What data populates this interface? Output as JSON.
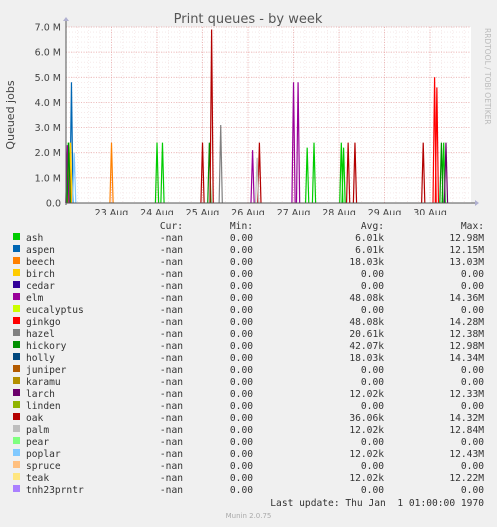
{
  "chart_data": {
    "type": "line",
    "title": "Print queues - by week",
    "ylabel": "Queued jobs",
    "side_text": "RRDTOOL / TOBI OETIKER",
    "ylim": [
      0,
      7000000
    ],
    "yticks": [
      {
        "value": 0,
        "label": "0.0"
      },
      {
        "value": 1000000,
        "label": "1.0 M"
      },
      {
        "value": 2000000,
        "label": "2.0 M"
      },
      {
        "value": 3000000,
        "label": "3.0 M"
      },
      {
        "value": 4000000,
        "label": "4.0 M"
      },
      {
        "value": 5000000,
        "label": "5.0 M"
      },
      {
        "value": 6000000,
        "label": "6.0 M"
      },
      {
        "value": 7000000,
        "label": "7.0 M"
      }
    ],
    "xlim": [
      22.0,
      30.9
    ],
    "xticks": [
      {
        "value": 23,
        "label": "23 Aug"
      },
      {
        "value": 24,
        "label": "24 Aug"
      },
      {
        "value": 25,
        "label": "25 Aug"
      },
      {
        "value": 26,
        "label": "26 Aug"
      },
      {
        "value": 27,
        "label": "27 Aug"
      },
      {
        "value": 28,
        "label": "28 Aug"
      },
      {
        "value": 29,
        "label": "29 Aug"
      },
      {
        "value": 30,
        "label": "30 Aug"
      }
    ],
    "series": [
      {
        "name": "ash",
        "color": "#00cc00",
        "spikes": [
          [
            22.05,
            2.4
          ],
          [
            24.0,
            2.4
          ],
          [
            24.12,
            2.4
          ],
          [
            27.3,
            2.2
          ],
          [
            27.45,
            2.4
          ],
          [
            28.05,
            2.4
          ],
          [
            28.1,
            2.2
          ],
          [
            30.3,
            2.4
          ]
        ]
      },
      {
        "name": "aspen",
        "color": "#0066b3",
        "spikes": [
          [
            22.12,
            4.8
          ]
        ]
      },
      {
        "name": "beech",
        "color": "#ff8000",
        "spikes": [
          [
            22.08,
            2.0
          ],
          [
            23.0,
            2.4
          ]
        ]
      },
      {
        "name": "birch",
        "color": "#ffcc00",
        "spikes": [
          [
            22.1,
            2.4
          ]
        ]
      },
      {
        "name": "cedar",
        "color": "#330099",
        "spikes": []
      },
      {
        "name": "elm",
        "color": "#990099",
        "spikes": [
          [
            22.03,
            2.3
          ],
          [
            26.1,
            2.1
          ],
          [
            27.0,
            4.8
          ],
          [
            27.1,
            4.8
          ]
        ]
      },
      {
        "name": "eucalyptus",
        "color": "#ccff00",
        "spikes": []
      },
      {
        "name": "ginkgo",
        "color": "#ff0000",
        "spikes": [
          [
            30.1,
            5.0
          ],
          [
            30.15,
            4.6
          ]
        ]
      },
      {
        "name": "hazel",
        "color": "#808080",
        "spikes": [
          [
            25.4,
            3.1
          ]
        ]
      },
      {
        "name": "hickory",
        "color": "#008f00",
        "spikes": [
          [
            22.06,
            2.4
          ],
          [
            25.15,
            2.4
          ],
          [
            30.25,
            2.4
          ]
        ]
      },
      {
        "name": "holly",
        "color": "#00487d",
        "spikes": []
      },
      {
        "name": "juniper",
        "color": "#b35a00",
        "spikes": []
      },
      {
        "name": "karamu",
        "color": "#b38f00",
        "spikes": []
      },
      {
        "name": "larch",
        "color": "#6b006b",
        "spikes": [
          [
            30.35,
            2.4
          ]
        ]
      },
      {
        "name": "linden",
        "color": "#8fb300",
        "spikes": []
      },
      {
        "name": "oak",
        "color": "#b30000",
        "spikes": [
          [
            25.0,
            2.4
          ],
          [
            25.2,
            6.9
          ],
          [
            26.25,
            2.4
          ],
          [
            28.2,
            2.4
          ],
          [
            28.35,
            2.4
          ],
          [
            29.85,
            2.4
          ]
        ]
      },
      {
        "name": "palm",
        "color": "#bebebe",
        "spikes": [
          [
            26.2,
            1.8
          ]
        ]
      },
      {
        "name": "pear",
        "color": "#80ff80",
        "spikes": []
      },
      {
        "name": "poplar",
        "color": "#80c9ff",
        "spikes": [
          [
            22.18,
            2.0
          ]
        ]
      },
      {
        "name": "spruce",
        "color": "#ffc080",
        "spikes": []
      },
      {
        "name": "teak",
        "color": "#ffe680",
        "spikes": []
      },
      {
        "name": "tnh23prntr",
        "color": "#aa80ff",
        "spikes": []
      }
    ]
  },
  "legend": {
    "headers": {
      "cur": "Cur:",
      "min": "Min:",
      "avg": "Avg:",
      "max": "Max:"
    },
    "rows": [
      {
        "name": "ash",
        "color": "#00cc00",
        "cur": "-nan",
        "min": "0.00",
        "avg": "6.01k",
        "max": "12.98M"
      },
      {
        "name": "aspen",
        "color": "#0066b3",
        "cur": "-nan",
        "min": "0.00",
        "avg": "6.01k",
        "max": "12.15M"
      },
      {
        "name": "beech",
        "color": "#ff8000",
        "cur": "-nan",
        "min": "0.00",
        "avg": "18.03k",
        "max": "13.03M"
      },
      {
        "name": "birch",
        "color": "#ffcc00",
        "cur": "-nan",
        "min": "0.00",
        "avg": "0.00",
        "max": "0.00"
      },
      {
        "name": "cedar",
        "color": "#330099",
        "cur": "-nan",
        "min": "0.00",
        "avg": "0.00",
        "max": "0.00"
      },
      {
        "name": "elm",
        "color": "#990099",
        "cur": "-nan",
        "min": "0.00",
        "avg": "48.08k",
        "max": "14.36M"
      },
      {
        "name": "eucalyptus",
        "color": "#ccff00",
        "cur": "-nan",
        "min": "0.00",
        "avg": "0.00",
        "max": "0.00"
      },
      {
        "name": "ginkgo",
        "color": "#ff0000",
        "cur": "-nan",
        "min": "0.00",
        "avg": "48.08k",
        "max": "14.28M"
      },
      {
        "name": "hazel",
        "color": "#808080",
        "cur": "-nan",
        "min": "0.00",
        "avg": "20.61k",
        "max": "12.38M"
      },
      {
        "name": "hickory",
        "color": "#008f00",
        "cur": "-nan",
        "min": "0.00",
        "avg": "42.07k",
        "max": "12.98M"
      },
      {
        "name": "holly",
        "color": "#00487d",
        "cur": "-nan",
        "min": "0.00",
        "avg": "18.03k",
        "max": "14.34M"
      },
      {
        "name": "juniper",
        "color": "#b35a00",
        "cur": "-nan",
        "min": "0.00",
        "avg": "0.00",
        "max": "0.00"
      },
      {
        "name": "karamu",
        "color": "#b38f00",
        "cur": "-nan",
        "min": "0.00",
        "avg": "0.00",
        "max": "0.00"
      },
      {
        "name": "larch",
        "color": "#6b006b",
        "cur": "-nan",
        "min": "0.00",
        "avg": "12.02k",
        "max": "12.33M"
      },
      {
        "name": "linden",
        "color": "#8fb300",
        "cur": "-nan",
        "min": "0.00",
        "avg": "0.00",
        "max": "0.00"
      },
      {
        "name": "oak",
        "color": "#b30000",
        "cur": "-nan",
        "min": "0.00",
        "avg": "36.06k",
        "max": "14.32M"
      },
      {
        "name": "palm",
        "color": "#bebebe",
        "cur": "-nan",
        "min": "0.00",
        "avg": "12.02k",
        "max": "12.84M"
      },
      {
        "name": "pear",
        "color": "#80ff80",
        "cur": "-nan",
        "min": "0.00",
        "avg": "0.00",
        "max": "0.00"
      },
      {
        "name": "poplar",
        "color": "#80c9ff",
        "cur": "-nan",
        "min": "0.00",
        "avg": "12.02k",
        "max": "12.43M"
      },
      {
        "name": "spruce",
        "color": "#ffc080",
        "cur": "-nan",
        "min": "0.00",
        "avg": "0.00",
        "max": "0.00"
      },
      {
        "name": "teak",
        "color": "#ffe680",
        "cur": "-nan",
        "min": "0.00",
        "avg": "12.02k",
        "max": "12.22M"
      },
      {
        "name": "tnh23prntr",
        "color": "#aa80ff",
        "cur": "-nan",
        "min": "0.00",
        "avg": "0.00",
        "max": "0.00"
      }
    ]
  },
  "footer": {
    "last_update": "Last update: Thu Jan  1 01:00:00 1970",
    "version": "Munin 2.0.75"
  }
}
